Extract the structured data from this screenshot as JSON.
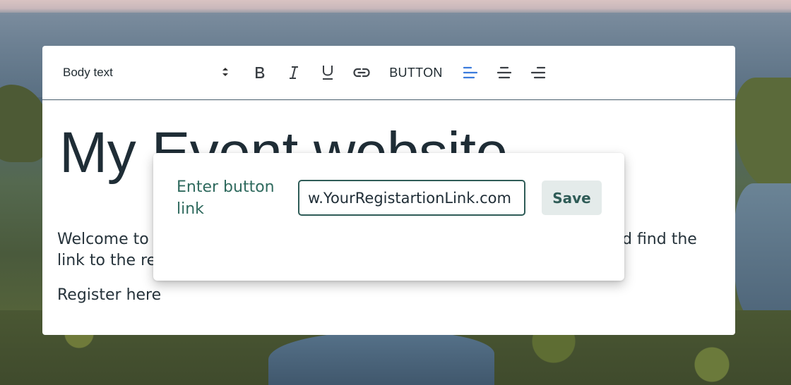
{
  "toolbar": {
    "text_style": "Body text",
    "button_label": "BUTTON"
  },
  "editor": {
    "heading": "My Event website",
    "body_text": "Welcome to my event website. Here you can read all about the event and find the link to the registration.",
    "register_link": "Register here"
  },
  "popover": {
    "label": "Enter button link",
    "input_value": "w.YourRegistartionLink.com",
    "save_label": "Save"
  },
  "colors": {
    "accent_blue": "#3b7bdc",
    "teal_text": "#2f6a5e",
    "dark_text": "#1f2d36"
  }
}
